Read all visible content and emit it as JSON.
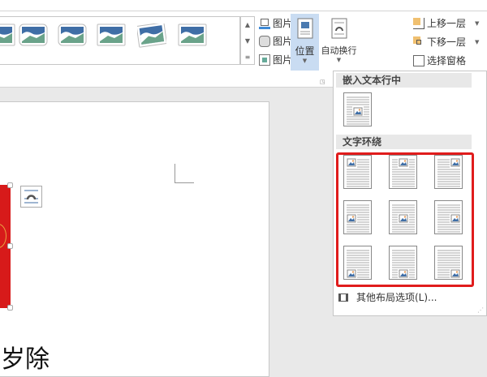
{
  "ribbon": {
    "picture_styles_count": 6,
    "picture_border": "图片边框",
    "picture_effects": "图片效果",
    "picture_layout": "图片版式",
    "position": "位置",
    "wrap_text": "自动换行",
    "bring_forward": "上移一层",
    "send_backward": "下移一层",
    "selection_pane": "选择窗格"
  },
  "dropdown": {
    "inline_header": "嵌入文本行中",
    "wrap_header": "文字环绕",
    "more_layout": "其他布局选项(L)...",
    "wrap_options": [
      "top-left",
      "top-center",
      "top-right",
      "middle-left",
      "middle-center",
      "middle-right",
      "bottom-left",
      "bottom-center",
      "bottom-right"
    ]
  },
  "document": {
    "text": "岁除"
  },
  "colors": {
    "highlight": "#c9dcf2",
    "red_box": "#e01c1c",
    "image_red": "#d71a1a",
    "accent": "#3f6ea6"
  }
}
